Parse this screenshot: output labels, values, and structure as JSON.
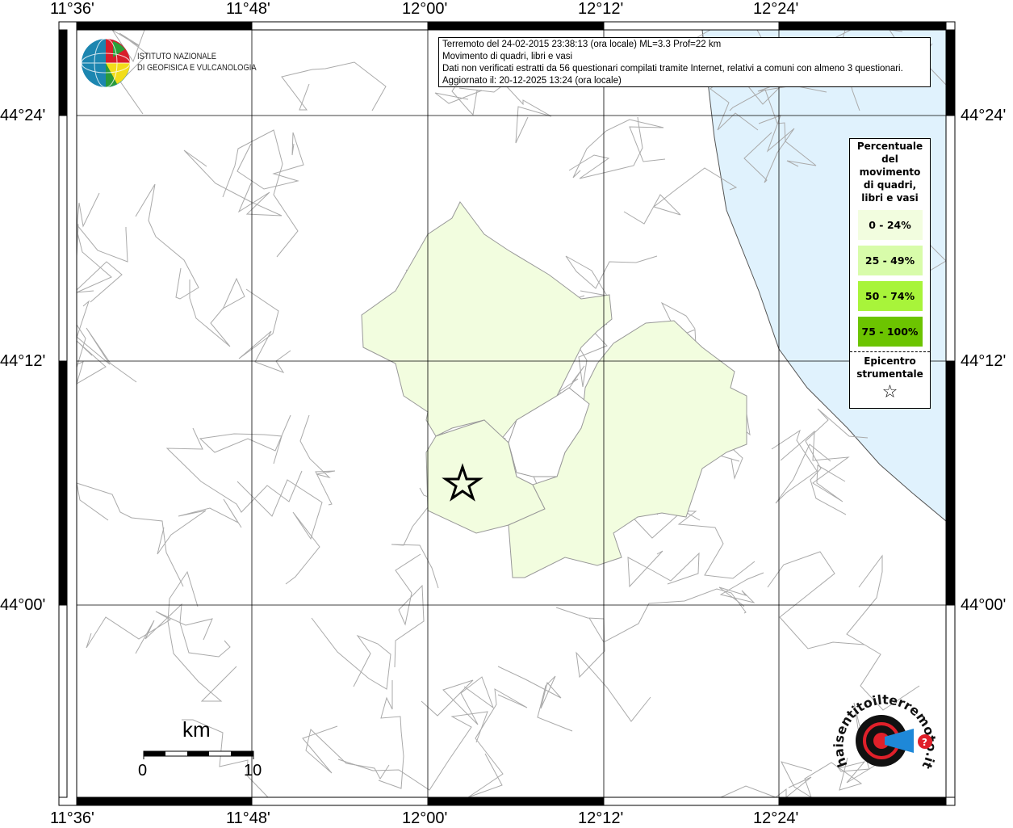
{
  "info": {
    "line1": "Terremoto del 24-02-2015 23:38:13 (ora locale) ML=3.3 Prof=22 km",
    "line2": "Movimento di quadri, libri e vasi",
    "line3": "Dati non verificati estratti da 56 questionari compilati tramite Internet, relativi a comuni con almeno 3 questionari.",
    "line4": "Aggiornato il: 20-12-2025 13:24 (ora locale)"
  },
  "axes": {
    "longitudes": [
      "11°36'",
      "11°48'",
      "12°00'",
      "12°12'",
      "12°24'"
    ],
    "latitudes": [
      "44°24'",
      "44°12'",
      "44°00'"
    ]
  },
  "legend": {
    "title_lines": [
      "Percentuale",
      "del",
      "movimento",
      "di quadri,",
      "libri e vasi"
    ],
    "classes": [
      {
        "label": "0 - 24%",
        "color": "#f2fddf"
      },
      {
        "label": "25 - 49%",
        "color": "#d8fcaa"
      },
      {
        "label": "50 - 74%",
        "color": "#a8f43a"
      },
      {
        "label": "75 - 100%",
        "color": "#6cc400"
      }
    ],
    "epicenter_lines": [
      "Epicentro",
      "strumentale"
    ],
    "epicenter_icon": "star-outline-icon"
  },
  "scale": {
    "unit": "km",
    "min": "0",
    "max": "10"
  },
  "logos": {
    "ingv": "ISTITUTO NAZIONALE DI GEOFISICA E VULCANOLOGIA",
    "ingv_line1": "ISTITUTO NAZIONALE",
    "ingv_line2": "DI GEOFISICA E VULCANOLOGIA",
    "hst": "www.haisentitoilterremoto.it"
  },
  "colors": {
    "sea": "#e0f2fd",
    "low_class": "#f2fddf",
    "boundaries": "#aaaaaa"
  }
}
